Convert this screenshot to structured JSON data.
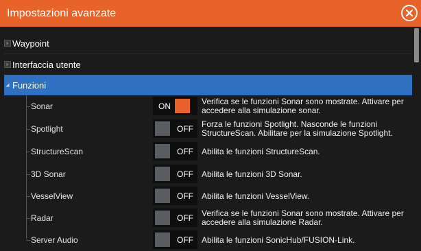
{
  "window": {
    "title": "Impostazioni avanzate"
  },
  "sections": [
    {
      "label": "Waypoint",
      "expanded": false
    },
    {
      "label": "Interfaccia utente",
      "expanded": false
    },
    {
      "label": "Funzioni",
      "expanded": true
    }
  ],
  "features": [
    {
      "name": "Sonar",
      "state": "ON",
      "description": "Verifica se le funzioni Sonar sono mostrate. Attivare per accedere alla simulazione sonar."
    },
    {
      "name": "Spotlight",
      "state": "OFF",
      "description": "Forza le funzioni Spotlight. Nasconde le funzioni StructureScan. Abilitare per la simulazione Spotlight."
    },
    {
      "name": "StructureScan",
      "state": "OFF",
      "description": "Abilita le funzioni StructureScan."
    },
    {
      "name": "3D Sonar",
      "state": "OFF",
      "description": "Abilita le funzioni 3D Sonar."
    },
    {
      "name": "VesselView",
      "state": "OFF",
      "description": "Abilita le funzioni VesselView."
    },
    {
      "name": "Radar",
      "state": "OFF",
      "description": "Verifica se le funzioni Sonar sono mostrate. Attivare per accedere alla simulazione Radar."
    },
    {
      "name": "Server Audio",
      "state": "OFF",
      "description": "Abilita le funzioni SonicHub/FUSION-Link."
    }
  ],
  "colors": {
    "accent": "#e8632a",
    "selection": "#2f70c1",
    "background": "#1b1b1b"
  }
}
